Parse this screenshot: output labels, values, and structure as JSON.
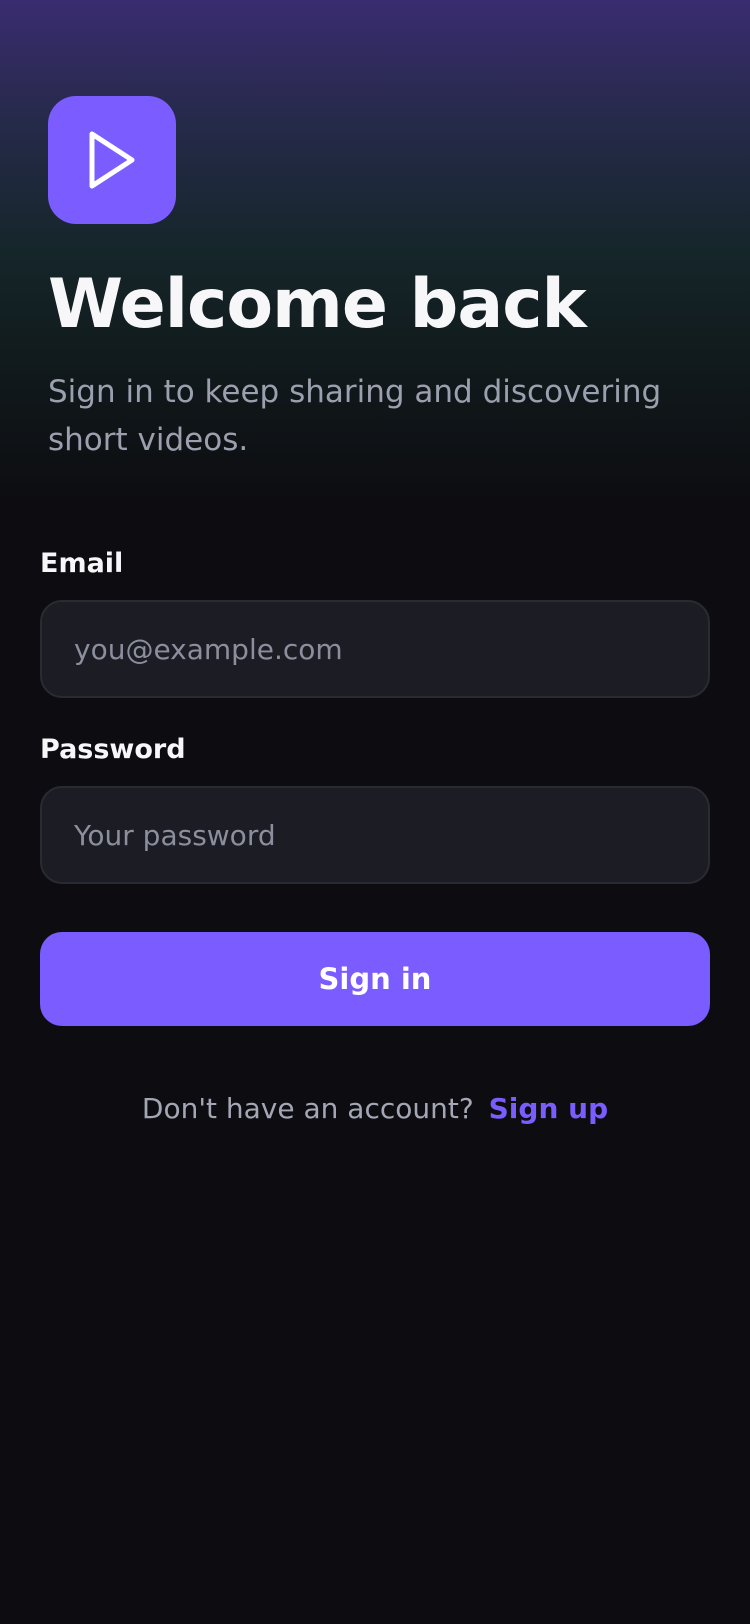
{
  "app": {
    "logo_icon": "play-icon",
    "accent_color": "#7b5cff"
  },
  "header": {
    "title": "Welcome back",
    "subtitle": "Sign in to keep sharing and discovering short videos."
  },
  "form": {
    "email": {
      "label": "Email",
      "placeholder": "you@example.com",
      "value": ""
    },
    "password": {
      "label": "Password",
      "placeholder": "Your password",
      "value": ""
    },
    "submit_label": "Sign in"
  },
  "footer": {
    "prompt": "Don't have an account?",
    "signup_label": "Sign up"
  }
}
